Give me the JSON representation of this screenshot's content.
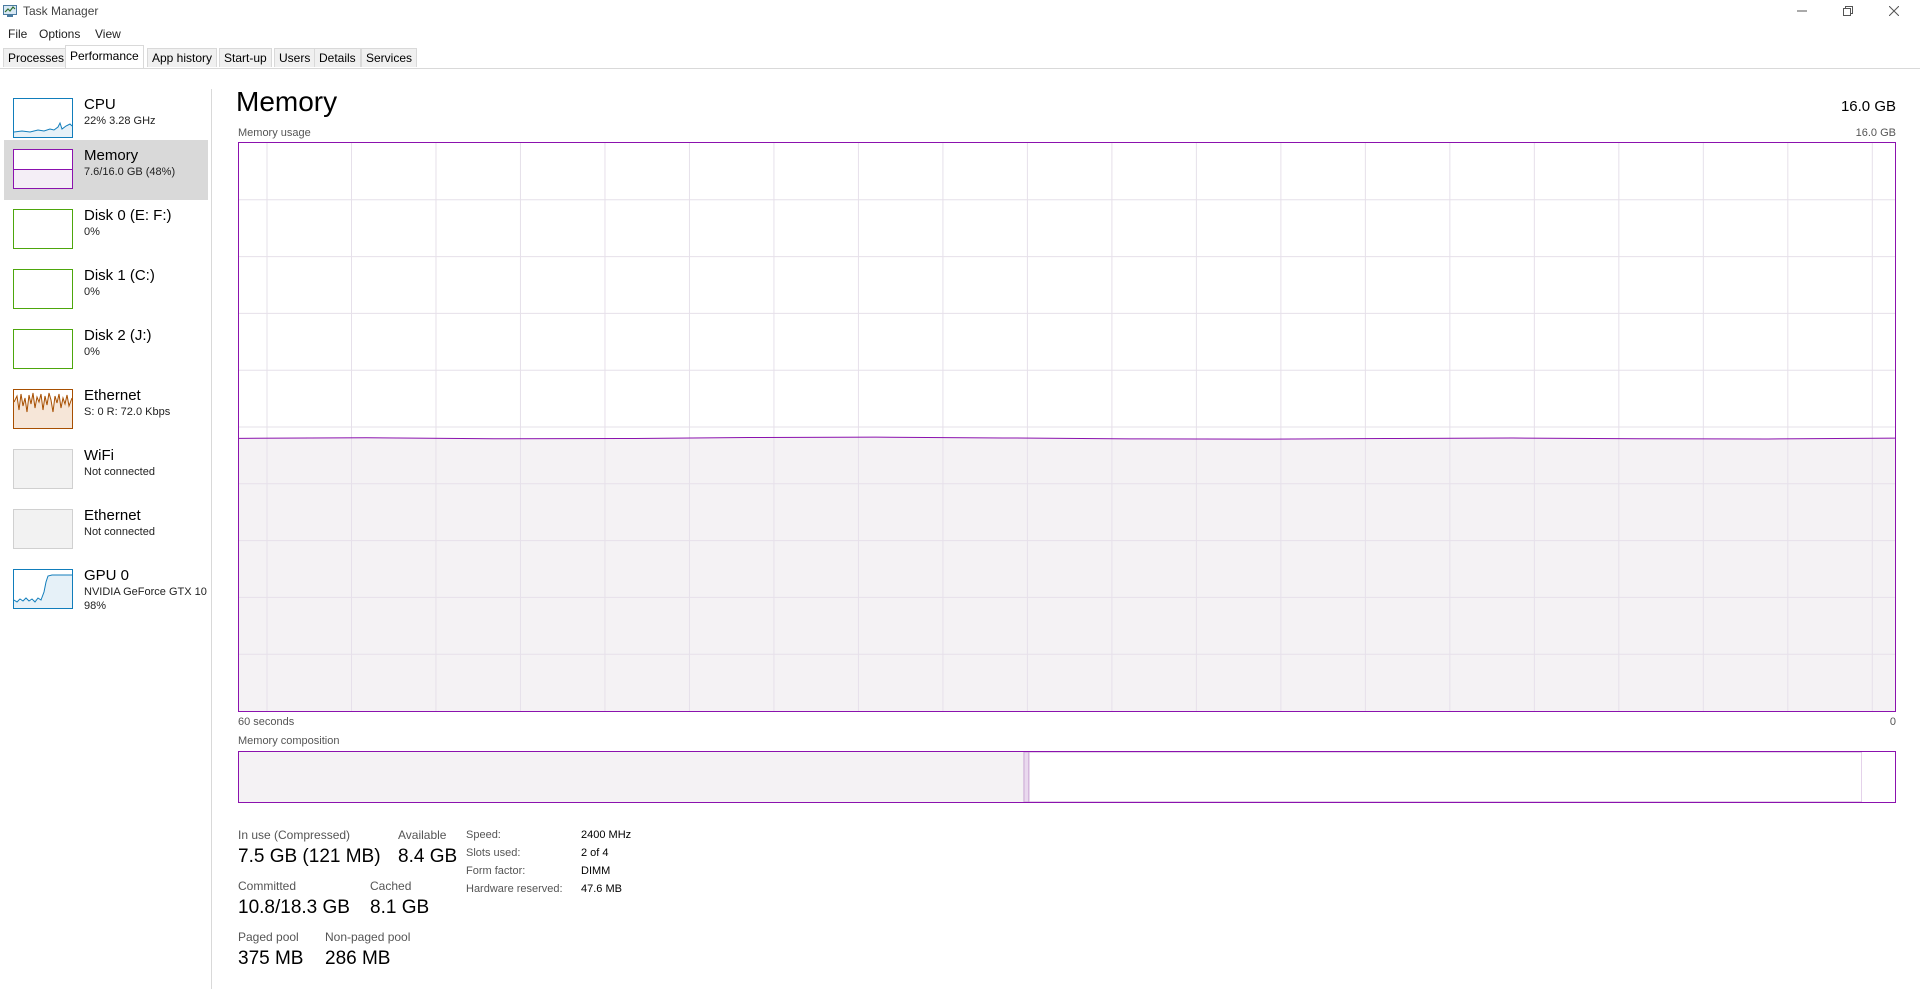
{
  "window": {
    "title": "Task Manager"
  },
  "menu": [
    {
      "label": "File"
    },
    {
      "label": "Options"
    },
    {
      "label": "View"
    }
  ],
  "tabs": [
    {
      "label": "Processes"
    },
    {
      "label": "Performance"
    },
    {
      "label": "App history"
    },
    {
      "label": "Start-up"
    },
    {
      "label": "Users"
    },
    {
      "label": "Details"
    },
    {
      "label": "Services"
    }
  ],
  "sidebar": {
    "items": [
      {
        "name": "CPU",
        "sub": "22%  3.28 GHz",
        "color": "#117dbb"
      },
      {
        "name": "Memory",
        "sub": "7.6/16.0 GB (48%)",
        "color": "#8b12ae",
        "percent": 48
      },
      {
        "name": "Disk 0 (E: F:)",
        "sub": "0%",
        "color": "#4da60c"
      },
      {
        "name": "Disk 1 (C:)",
        "sub": "0%",
        "color": "#4da60c"
      },
      {
        "name": "Disk 2 (J:)",
        "sub": "0%",
        "color": "#4da60c"
      },
      {
        "name": "Ethernet",
        "sub": "S: 0  R: 72.0 Kbps",
        "color": "#a74f01"
      },
      {
        "name": "WiFi",
        "sub": "Not connected",
        "color": "#b0b0b0"
      },
      {
        "name": "Ethernet",
        "sub": "Not connected",
        "color": "#b0b0b0"
      },
      {
        "name": "GPU 0",
        "sub": "NVIDIA GeForce GTX 10",
        "sub2": "98%",
        "color": "#117dbb"
      }
    ]
  },
  "main": {
    "title": "Memory",
    "total": "16.0 GB",
    "usage_label": "Memory usage",
    "usage_max": "16.0 GB",
    "time_left": "60 seconds",
    "time_right": "0",
    "composition_label": "Memory composition",
    "usage_percent": 48,
    "composition": {
      "in_use_fraction": 0.474,
      "modified_fraction": 0.003,
      "standby_fraction": 0.503,
      "free_fraction": 0.02
    }
  },
  "stats": {
    "in_use_label": "In use (Compressed)",
    "in_use_value": "7.5 GB (121 MB)",
    "available_label": "Available",
    "available_value": "8.4 GB",
    "committed_label": "Committed",
    "committed_value": "10.8/18.3 GB",
    "cached_label": "Cached",
    "cached_value": "8.1 GB",
    "paged_label": "Paged pool",
    "paged_value": "375 MB",
    "nonpaged_label": "Non-paged pool",
    "nonpaged_value": "286 MB"
  },
  "specs": {
    "speed_label": "Speed:",
    "speed_value": "2400 MHz",
    "slots_label": "Slots used:",
    "slots_value": "2 of 4",
    "form_label": "Form factor:",
    "form_value": "DIMM",
    "hw_label": "Hardware reserved:",
    "hw_value": "47.6 MB"
  },
  "colors": {
    "memory": "#8b12ae",
    "graph_fill": "#f4f2f4",
    "grid": "#e6e0ea"
  },
  "icons": {
    "app": "task-manager-icon",
    "minimize": "minimize-icon",
    "restore": "restore-icon",
    "close": "close-icon"
  }
}
